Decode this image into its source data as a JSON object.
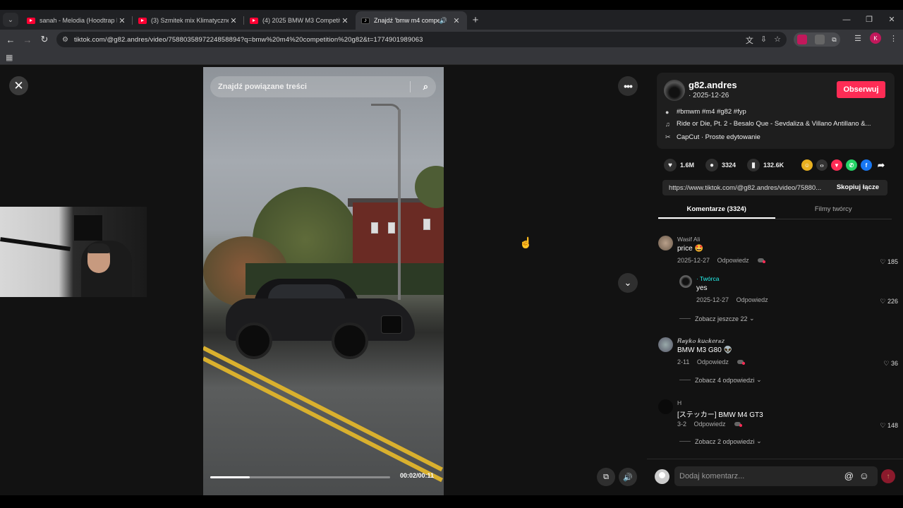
{
  "browser": {
    "tabs": [
      {
        "title": "sanah - Melodia (Hoodtrap Rem",
        "favicon": "youtube-icon",
        "active": false
      },
      {
        "title": "(3) Szmitek mix Klimatyczne Brz",
        "favicon": "youtube-icon",
        "active": false
      },
      {
        "title": "(4) 2025 BMW M3 Competition",
        "favicon": "youtube-icon",
        "active": false
      },
      {
        "title": "Znajdź 'bmw m4 competiti",
        "favicon": "tiktok-icon",
        "active": true
      }
    ],
    "url": "tiktok.com/@g82.andres/video/7588035897224858894?q=bmw%20m4%20competition%20g82&t=1774901989063",
    "profile_initial": "K"
  },
  "video": {
    "search_placeholder": "Znajdź powiązane treści",
    "timecode": "00:02/00:11",
    "progress": 0.22
  },
  "post": {
    "username": "g82.andres",
    "date": "· 2025-12-26",
    "follow_label": "Obserwuj",
    "hashtags": "#bmwm #m4 #g82 #fyp",
    "music": "Ride or Die, Pt. 2 - Besalo Que - Sevdaliza & Villano Antillano &...",
    "editor": "CapCut · Proste edytowanie",
    "likes": "1.6M",
    "comments": "3324",
    "saves": "132.6K",
    "link": "https://www.tiktok.com/@g82.andres/video/75880...",
    "copy_label": "Skopiuj łącze"
  },
  "panel_tabs": {
    "comments": "Komentarze (3324)",
    "creator_videos": "Filmy twórcy"
  },
  "comments": [
    {
      "author": "Wasif Ali",
      "text": "price 🤩",
      "date": "2025-12-27",
      "reply": "Odpowiedz",
      "likes": "185"
    },
    {
      "author": "𝑹𝒂𝒚𝒌𝒐 𝒌𝒖𝒄𝒌𝒆𝒓𝒔𝒛",
      "text": "BMW M3 G80 👽",
      "date": "2-11",
      "reply": "Odpowiedz",
      "likes": "36"
    },
    {
      "author": "H",
      "text": "[ステッカー] BMW M4 GT3",
      "date": "3-2",
      "reply": "Odpowiedz",
      "likes": "148"
    }
  ],
  "creator_reply": {
    "badge": "· Twórca",
    "text": "yes",
    "date": "2025-12-27",
    "reply": "Odpowiedz",
    "likes": "226"
  },
  "more_replies": [
    "Zobacz jeszcze 22",
    "Zobacz 4 odpowiedzi",
    "Zobacz 2 odpowiedzi"
  ],
  "composer": {
    "placeholder": "Dodaj komentarz..."
  },
  "colors": {
    "accent": "#fe2c55",
    "creator_badge": "#25f4ee"
  }
}
